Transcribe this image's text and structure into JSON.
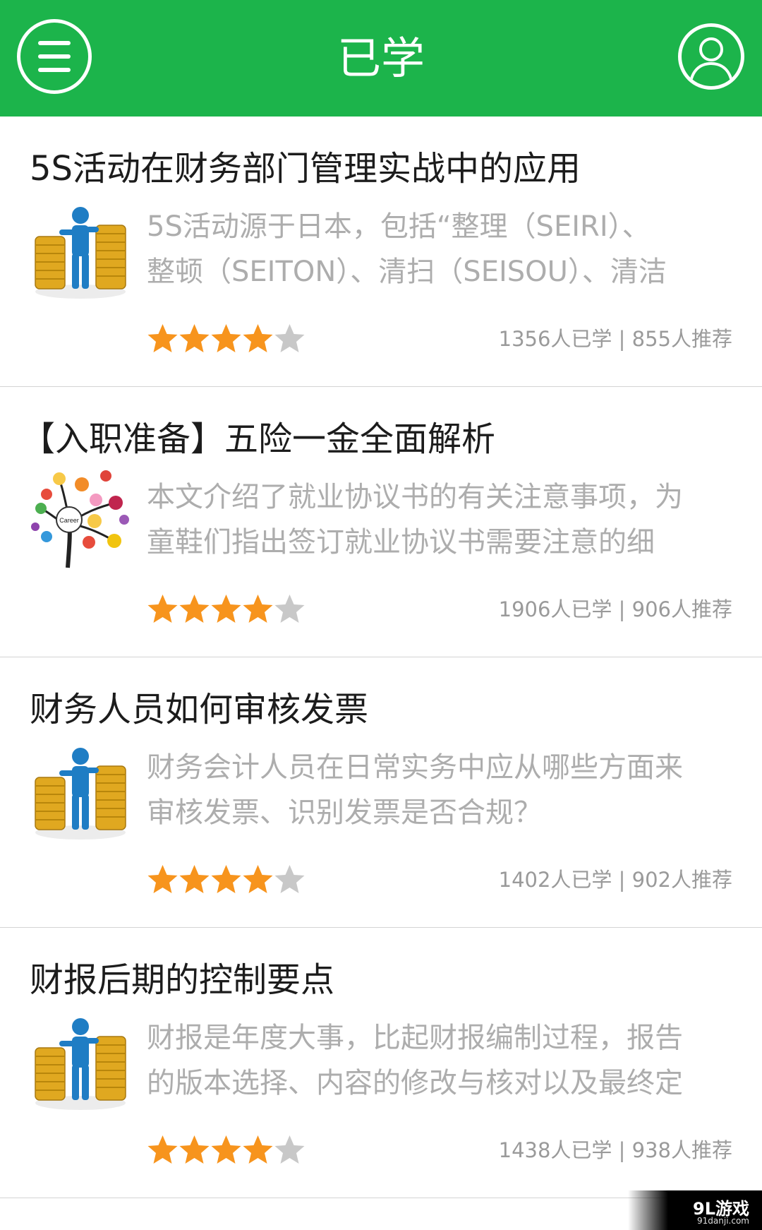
{
  "header": {
    "title": "已学",
    "menu_icon": "hamburger-menu-icon",
    "profile_icon": "user-profile-icon",
    "bg_color": "#1cb44b"
  },
  "items": [
    {
      "title": "5S活动在财务部门管理实战中的应用",
      "desc_line1": "5S活动源于日本，包括“整理（SEIRI）、",
      "desc_line2": "整顿（SEITON）、清扫（SEISOU）、清洁",
      "thumb": "coins-figure",
      "rating": 4,
      "stats": "1356人已学 | 855人推荐"
    },
    {
      "title": "【入职准备】五险一金全面解析",
      "desc_line1": "本文介绍了就业协议书的有关注意事项，为",
      "desc_line2": "童鞋们指出签订就业协议书需要注意的细",
      "thumb": "career-tree",
      "thumb_label": "Career",
      "rating": 4,
      "stats": "1906人已学 | 906人推荐"
    },
    {
      "title": "财务人员如何审核发票",
      "desc_line1": "财务会计人员在日常实务中应从哪些方面来",
      "desc_line2": "审核发票、识别发票是否合规？",
      "thumb": "coins-figure",
      "rating": 4,
      "stats": "1402人已学 | 902人推荐"
    },
    {
      "title": "财报后期的控制要点",
      "desc_line1": "财报是年度大事，比起财报编制过程，报告",
      "desc_line2": "的版本选择、内容的修改与核对以及最终定",
      "thumb": "coins-figure",
      "rating": 4,
      "stats": "1438人已学 | 938人推荐"
    }
  ],
  "colors": {
    "star_on": "#f7941d",
    "star_off": "#c8c8c8",
    "coin": "#e0a820",
    "figure": "#1f7dc4"
  },
  "watermark": {
    "main": "9L游戏",
    "sub": "91danji.com"
  }
}
